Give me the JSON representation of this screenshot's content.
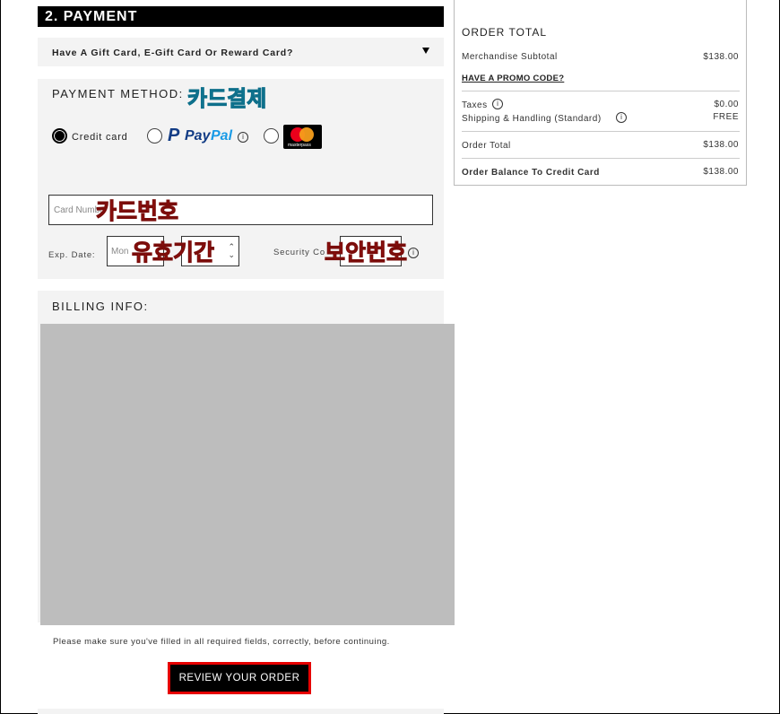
{
  "payment": {
    "header": "2. PAYMENT",
    "gift_card_prompt": "Have A Gift Card, E-Gift Card Or Reward Card?",
    "method_label": "PAYMENT METHOD:",
    "options": {
      "credit_card": "Credit card",
      "paypal_p": "P",
      "paypal_pay": "Pay",
      "paypal_pal": "Pal",
      "masterpass": "masterpass"
    },
    "card_number_placeholder": "Card Numbe",
    "exp_label": "Exp. Date:",
    "month_placeholder": "Mon",
    "security_label": "Security Co",
    "info_glyph": "i"
  },
  "annotations": {
    "card_payment": "카드결제",
    "card_number": "카드번호",
    "expiry": "유효기간",
    "security_code": "보안번호"
  },
  "billing": {
    "label": "BILLING INFO:"
  },
  "footer": {
    "note": "Please make sure you've filled in all required fields, correctly, before continuing.",
    "review_button": "REVIEW YOUR ORDER"
  },
  "order": {
    "title": "ORDER TOTAL",
    "merch_label": "Merchandise Subtotal",
    "merch_value": "$138.00",
    "promo": "HAVE A PROMO CODE?",
    "taxes_label": "Taxes",
    "taxes_value": "$0.00",
    "shipping_label": "Shipping & Handling (Standard)",
    "shipping_value": "FREE",
    "order_total_label": "Order Total",
    "order_total_value": "$138.00",
    "balance_label": "Order Balance To Credit Card",
    "balance_value": "$138.00"
  },
  "colors": {
    "accent_red": "#e60000",
    "annotation_red": "#e8231f",
    "annotation_cyan": "#27b3d8",
    "paypal_dark": "#123c85",
    "paypal_light": "#1a9be6"
  }
}
